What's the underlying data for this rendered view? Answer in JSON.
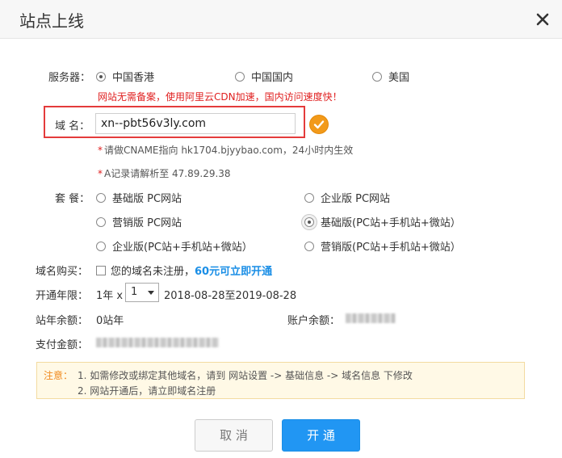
{
  "dialog": {
    "title": "站点上线",
    "close_icon": "close-icon"
  },
  "server": {
    "label": "服务器：",
    "options": [
      "中国香港",
      "中国国内",
      "美国"
    ],
    "selected": "中国香港",
    "note": "网站无需备案，使用阿里云CDN加速，国内访问速度快！"
  },
  "domain": {
    "label": "域  名：",
    "value": "xn--pbt56v3ly.com",
    "status_icon": "check-circle-icon",
    "hint_cname": "请做CNAME指向 hk1704.bjyybao.com，24小时内生效",
    "hint_a": "A记录请解析至 47.89.29.38",
    "star": "*"
  },
  "package": {
    "label": "套  餐：",
    "options": [
      "基础版 PC网站",
      "企业版 PC网站",
      "营销版 PC网站",
      "基础版(PC站+手机站+微站）",
      "企业版(PC站+手机站+微站）",
      "营销版(PC站+手机站+微站）"
    ],
    "selected": "基础版(PC站+手机站+微站）"
  },
  "purchase": {
    "label": "域名购买：",
    "checkbox_text": "您的域名未注册，",
    "link": "60元可立即开通"
  },
  "duration": {
    "label": "开通年限：",
    "prefix": "1年 x",
    "select_value": "1",
    "range": "2018-08-28至2019-08-28"
  },
  "balance": {
    "site_label": "站年余额：",
    "site_value": "0站年",
    "account_label": "账户余额："
  },
  "payment": {
    "label": "支付金额："
  },
  "notice": {
    "label": "注意：",
    "line1": "1. 如需修改或绑定其他域名，请到 网站设置 -> 基础信息 -> 域名信息 下修改",
    "line2": "2. 网站开通后，请立即域名注册"
  },
  "buttons": {
    "cancel": "取 消",
    "open": "开 通"
  },
  "colors": {
    "primary": "#2196f3",
    "highlight_border": "#e43b3b",
    "ok_orange": "#f29a1a",
    "note_red": "#e02020",
    "link_blue": "#1a8ee6",
    "notice_bg": "#fff9e6"
  }
}
